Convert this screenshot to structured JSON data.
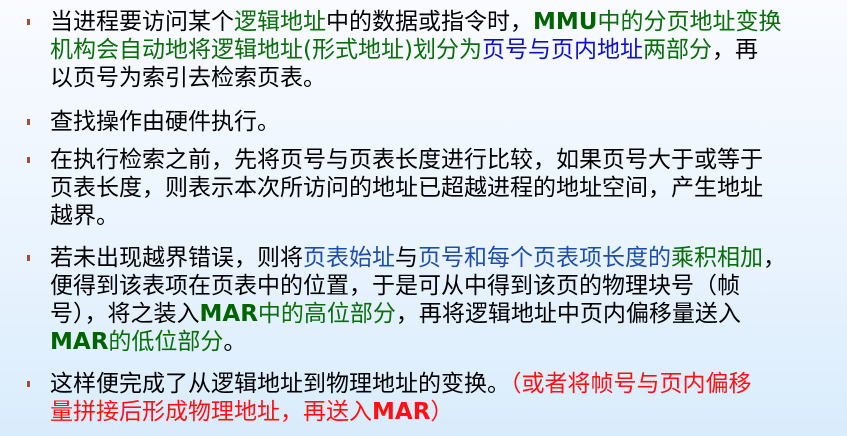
{
  "colors": {
    "green": "#0a6e0a",
    "blue": "#1010c8",
    "red": "#ff1010",
    "bullet": "#a05030"
  },
  "bullets": [
    {
      "lines": [
        [
          {
            "t": "当进程要访问某个",
            "s": "k"
          },
          {
            "t": "逻辑地址",
            "s": "g"
          },
          {
            "t": "中的数据或指令时，",
            "s": "k"
          },
          {
            "t": "MMU",
            "s": "gb"
          },
          {
            "t": "中的分页地址变换",
            "s": "g"
          }
        ],
        [
          {
            "t": "机构会自动地将逻辑地址(形式地址)划分为",
            "s": "g"
          },
          {
            "t": "页号与页内地址",
            "s": "b"
          },
          {
            "t": "两部分",
            "s": "g"
          },
          {
            "t": "，再",
            "s": "k"
          }
        ],
        [
          {
            "t": "以页号为索引去检索页表。",
            "s": "k"
          }
        ]
      ]
    },
    {
      "lines": [
        [
          {
            "t": "查找操作由硬件执行。",
            "s": "k"
          }
        ]
      ]
    },
    {
      "lines": [
        [
          {
            "t": "在执行检索之前，先将页号与页表长度进行比较，如果页号大于或等于",
            "s": "k"
          }
        ],
        [
          {
            "t": "页表长度，则表示本次所访问的地址已超越进程的地址空间，产生地址",
            "s": "k"
          }
        ],
        [
          {
            "t": "越界。",
            "s": "k"
          }
        ]
      ]
    },
    {
      "lines": [
        [
          {
            "t": "若未出现越界错误，则将",
            "s": "k"
          },
          {
            "t": "页表始址",
            "s": "b2"
          },
          {
            "t": "与",
            "s": "k"
          },
          {
            "t": "页号和每个页表项长度的",
            "s": "b2"
          },
          {
            "t": "乘积相加",
            "s": "g"
          },
          {
            "t": "，",
            "s": "k"
          }
        ],
        [
          {
            "t": "便得到该表项在页表中的位置，于是可从中得到该页的物理块号（帧",
            "s": "k"
          }
        ],
        [
          {
            "t": "号），将之装入",
            "s": "k"
          },
          {
            "t": "MAR",
            "s": "gb"
          },
          {
            "t": "中的高位部分",
            "s": "g"
          },
          {
            "t": "，再将逻辑地址中页内偏移量送入",
            "s": "k"
          }
        ],
        [
          {
            "t": "MAR",
            "s": "gb"
          },
          {
            "t": "的低位部分",
            "s": "g"
          },
          {
            "t": "。",
            "s": "k"
          }
        ]
      ]
    },
    {
      "lines": [
        [
          {
            "t": "这样便完成了从逻辑地址到物理地址的变换。",
            "s": "k"
          },
          {
            "t": "（或者将帧号与页内偏移",
            "s": "r"
          }
        ],
        [
          {
            "t": "量拼接后形成物理地址，再送入",
            "s": "r"
          },
          {
            "t": "MAR",
            "s": "rb"
          },
          {
            "t": "）",
            "s": "r"
          }
        ]
      ]
    }
  ]
}
